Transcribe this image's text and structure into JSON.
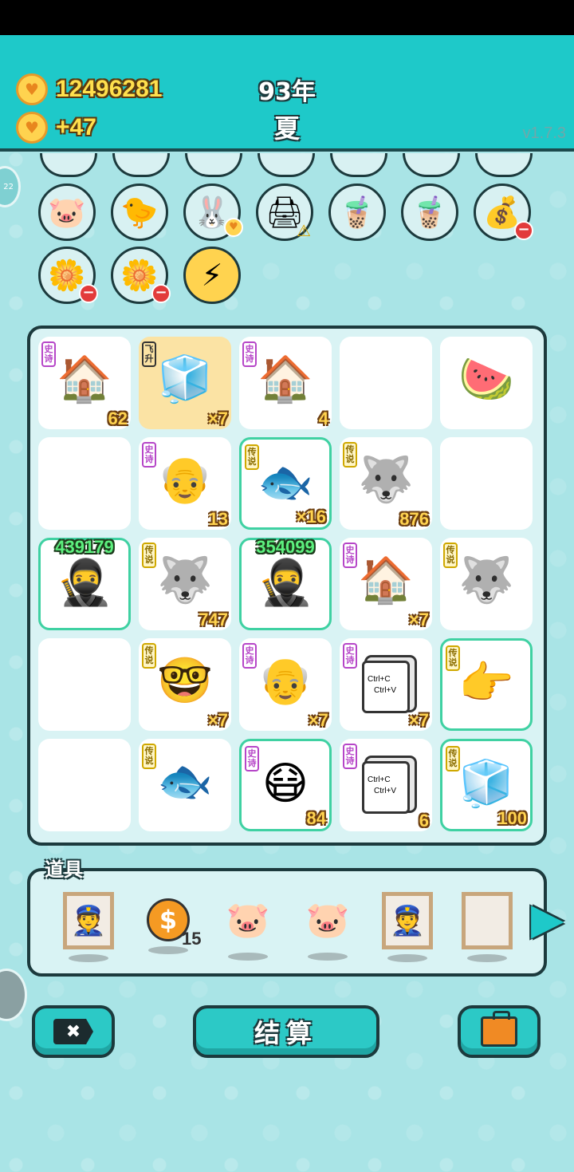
{
  "header": {
    "coins": "12496281",
    "income": "+47",
    "year": "93年",
    "season": "夏",
    "version": "v1.7.3",
    "coin_color": "#ffd34f",
    "header_color": "#1ec9c9"
  },
  "side_tab": {
    "text": "22"
  },
  "symbols_row1": [
    {
      "icon": "piggy-bank-icon",
      "glyph": "🐷",
      "badge": ""
    },
    {
      "icon": "chicken-icon",
      "glyph": "🐤",
      "badge": ""
    },
    {
      "icon": "rabbit-icon",
      "glyph": "🐰",
      "badge": "heart"
    },
    {
      "icon": "printer-icon",
      "glyph": "🖨",
      "badge": "warn"
    },
    {
      "icon": "bubble-tea-icon",
      "glyph": "🧋",
      "badge": ""
    },
    {
      "icon": "bubble-tea-icon",
      "glyph": "🧋",
      "badge": ""
    },
    {
      "icon": "money-bag-icon",
      "glyph": "💰",
      "badge": "minus"
    }
  ],
  "symbols_row2": [
    {
      "icon": "potted-flower-icon",
      "glyph": "🌼",
      "badge": "minus"
    },
    {
      "icon": "potted-flower-icon",
      "glyph": "🌼",
      "badge": "minus"
    },
    {
      "icon": "lightning-icon",
      "glyph": "⚡",
      "badge": ""
    }
  ],
  "board": {
    "cells": [
      {
        "icon": "rabbit-house-icon",
        "glyph": "🏠",
        "tag": "史诗",
        "tag_type": "epic",
        "count": "62"
      },
      {
        "icon": "fridge-icon",
        "glyph": "🧊",
        "tag": "飞升",
        "tag_type": "fly",
        "count": "×7",
        "highlight": true
      },
      {
        "icon": "rabbit-house-icon",
        "glyph": "🏠",
        "tag": "史诗",
        "tag_type": "epic",
        "count": "4"
      },
      {
        "icon": "",
        "glyph": "",
        "tag": "",
        "tag_type": "",
        "count": ""
      },
      {
        "icon": "watermelon-icon",
        "glyph": "🍉",
        "tag": "",
        "tag_type": "",
        "count": ""
      },
      {
        "icon": "",
        "glyph": "",
        "tag": "",
        "tag_type": "",
        "count": ""
      },
      {
        "icon": "old-man-icon",
        "glyph": "👴",
        "tag": "史诗",
        "tag_type": "epic",
        "count": "13"
      },
      {
        "icon": "koi-fish-icon",
        "glyph": "🐟",
        "tag": "传说",
        "tag_type": "legend",
        "count": "×16",
        "glow": true
      },
      {
        "icon": "husky-king-icon",
        "glyph": "🐺",
        "tag": "传说",
        "tag_type": "legend",
        "count": "876"
      },
      {
        "icon": "",
        "glyph": "",
        "tag": "",
        "tag_type": "",
        "count": ""
      },
      {
        "icon": "thief-icon",
        "glyph": "🥷",
        "tag": "",
        "tag_type": "",
        "count": "",
        "top_value": "439179",
        "glow": true
      },
      {
        "icon": "husky-king-icon",
        "glyph": "🐺",
        "tag": "传说",
        "tag_type": "legend",
        "count": "747"
      },
      {
        "icon": "thief-icon",
        "glyph": "🥷",
        "tag": "",
        "tag_type": "",
        "count": "",
        "top_value": "354099",
        "glow": true
      },
      {
        "icon": "rabbit-house-icon",
        "glyph": "🏠",
        "tag": "史诗",
        "tag_type": "epic",
        "count": "×7"
      },
      {
        "icon": "husky-king-icon",
        "glyph": "🐺",
        "tag": "传说",
        "tag_type": "legend",
        "count": ""
      },
      {
        "icon": "",
        "glyph": "",
        "tag": "",
        "tag_type": "",
        "count": ""
      },
      {
        "icon": "rich-old-man-icon",
        "glyph": "🤓",
        "tag": "传说",
        "tag_type": "legend",
        "count": "×7"
      },
      {
        "icon": "old-man-icon",
        "glyph": "👴",
        "tag": "史诗",
        "tag_type": "epic",
        "count": "×7"
      },
      {
        "icon": "ctrl-cv-icon",
        "glyph": "ctrl",
        "tag": "史诗",
        "tag_type": "epic",
        "count": "×7"
      },
      {
        "icon": "pointing-hand-icon",
        "glyph": "👉",
        "tag": "传说",
        "tag_type": "legend",
        "count": "",
        "glow": true
      },
      {
        "icon": "",
        "glyph": "",
        "tag": "",
        "tag_type": "",
        "count": ""
      },
      {
        "icon": "koi-fish-icon",
        "glyph": "🐟",
        "tag": "传说",
        "tag_type": "legend",
        "count": ""
      },
      {
        "icon": "masked-man-icon",
        "glyph": "😷",
        "tag": "史诗",
        "tag_type": "epic",
        "count": "84",
        "glow": true
      },
      {
        "icon": "ctrl-cv-icon",
        "glyph": "ctrl",
        "tag": "史诗",
        "tag_type": "epic",
        "count": "6"
      },
      {
        "icon": "fridge-icon",
        "glyph": "🧊",
        "tag": "传说",
        "tag_type": "legend",
        "count": "100",
        "glow": true
      }
    ],
    "ctrl_text_1": "Ctrl+C",
    "ctrl_text_2": "Ctrl+V"
  },
  "tools": {
    "label": "道具",
    "items": [
      {
        "icon": "police-portrait-icon",
        "glyph": "👮",
        "kind": "frame",
        "count": ""
      },
      {
        "icon": "dollar-coin-icon",
        "glyph": "$",
        "kind": "coin",
        "count": "15"
      },
      {
        "icon": "piggy-bank-icon",
        "glyph": "🐷",
        "kind": "plain",
        "count": ""
      },
      {
        "icon": "piggy-bank-icon",
        "glyph": "🐷",
        "kind": "plain",
        "count": ""
      },
      {
        "icon": "police-portrait-icon",
        "glyph": "👮",
        "kind": "frame",
        "count": ""
      },
      {
        "icon": "empty-frame-icon",
        "glyph": "",
        "kind": "frame",
        "count": ""
      }
    ]
  },
  "buttons": {
    "exit_glyph": "✖",
    "settle_label": "结算"
  }
}
